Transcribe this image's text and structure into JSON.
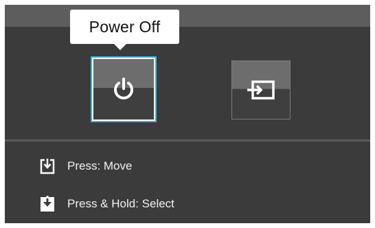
{
  "osd": {
    "tooltip": "Power Off",
    "items": [
      {
        "name": "Power Off",
        "icon": "power-icon",
        "selected": true
      },
      {
        "name": "Input",
        "icon": "input-source-icon",
        "selected": false
      }
    ]
  },
  "guide": {
    "move_label": "Press: Move",
    "select_label": "Press & Hold: Select",
    "move_icon": "press-move-icon",
    "select_icon": "press-hold-select-icon"
  },
  "colors": {
    "panel_background": "#3b3b3b",
    "selection_outline": "#35b6e6",
    "tooltip_background": "#ffffff"
  }
}
